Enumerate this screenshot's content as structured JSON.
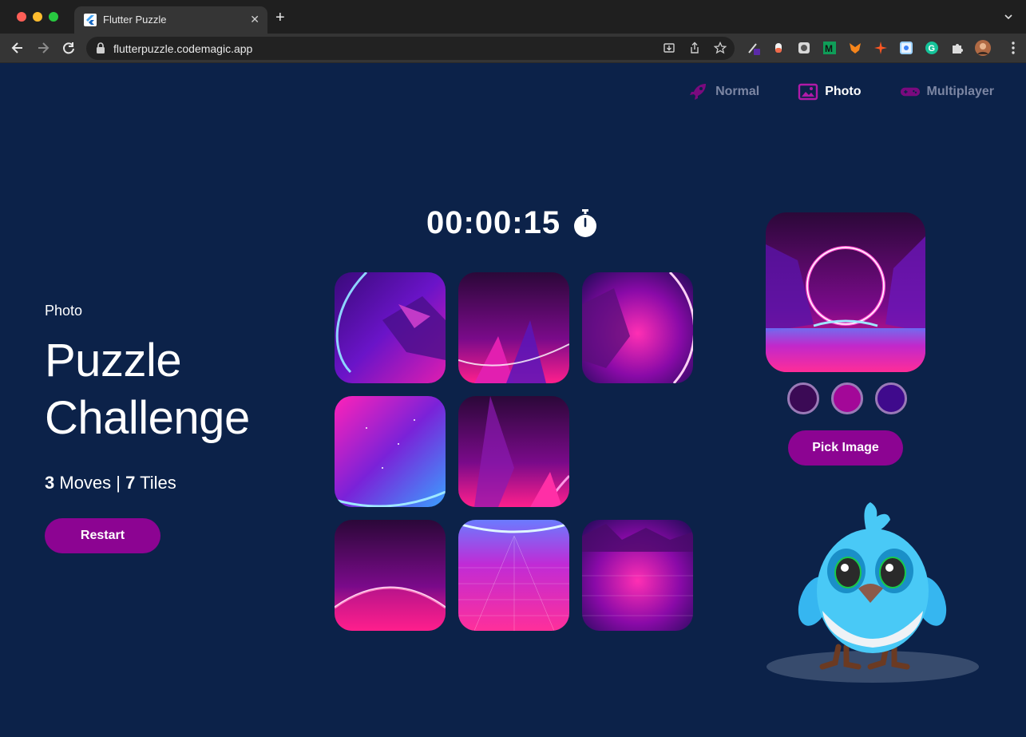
{
  "browser": {
    "tab_title": "Flutter Puzzle",
    "url": "flutterpuzzle.codemagic.app"
  },
  "modes": [
    {
      "label": "Normal",
      "icon": "rocket-icon",
      "active": false
    },
    {
      "label": "Photo",
      "icon": "image-icon",
      "active": true
    },
    {
      "label": "Multiplayer",
      "icon": "gamepad-icon",
      "active": false
    }
  ],
  "game": {
    "mode_label": "Photo",
    "title": "Puzzle Challenge",
    "moves": "3",
    "moves_label": " Moves | ",
    "tiles": "7",
    "tiles_label": " Tiles",
    "restart_label": "Restart",
    "timer": "00:00:15"
  },
  "board": {
    "size": 3,
    "empty_index": 5
  },
  "preview": {
    "swatches": [
      "#3b0a55",
      "#a30898",
      "#3f0a8c"
    ],
    "pick_label": "Pick Image"
  },
  "colors": {
    "background": "#0c2249",
    "accent": "#8c0492",
    "muted_text": "#7c86a3"
  }
}
